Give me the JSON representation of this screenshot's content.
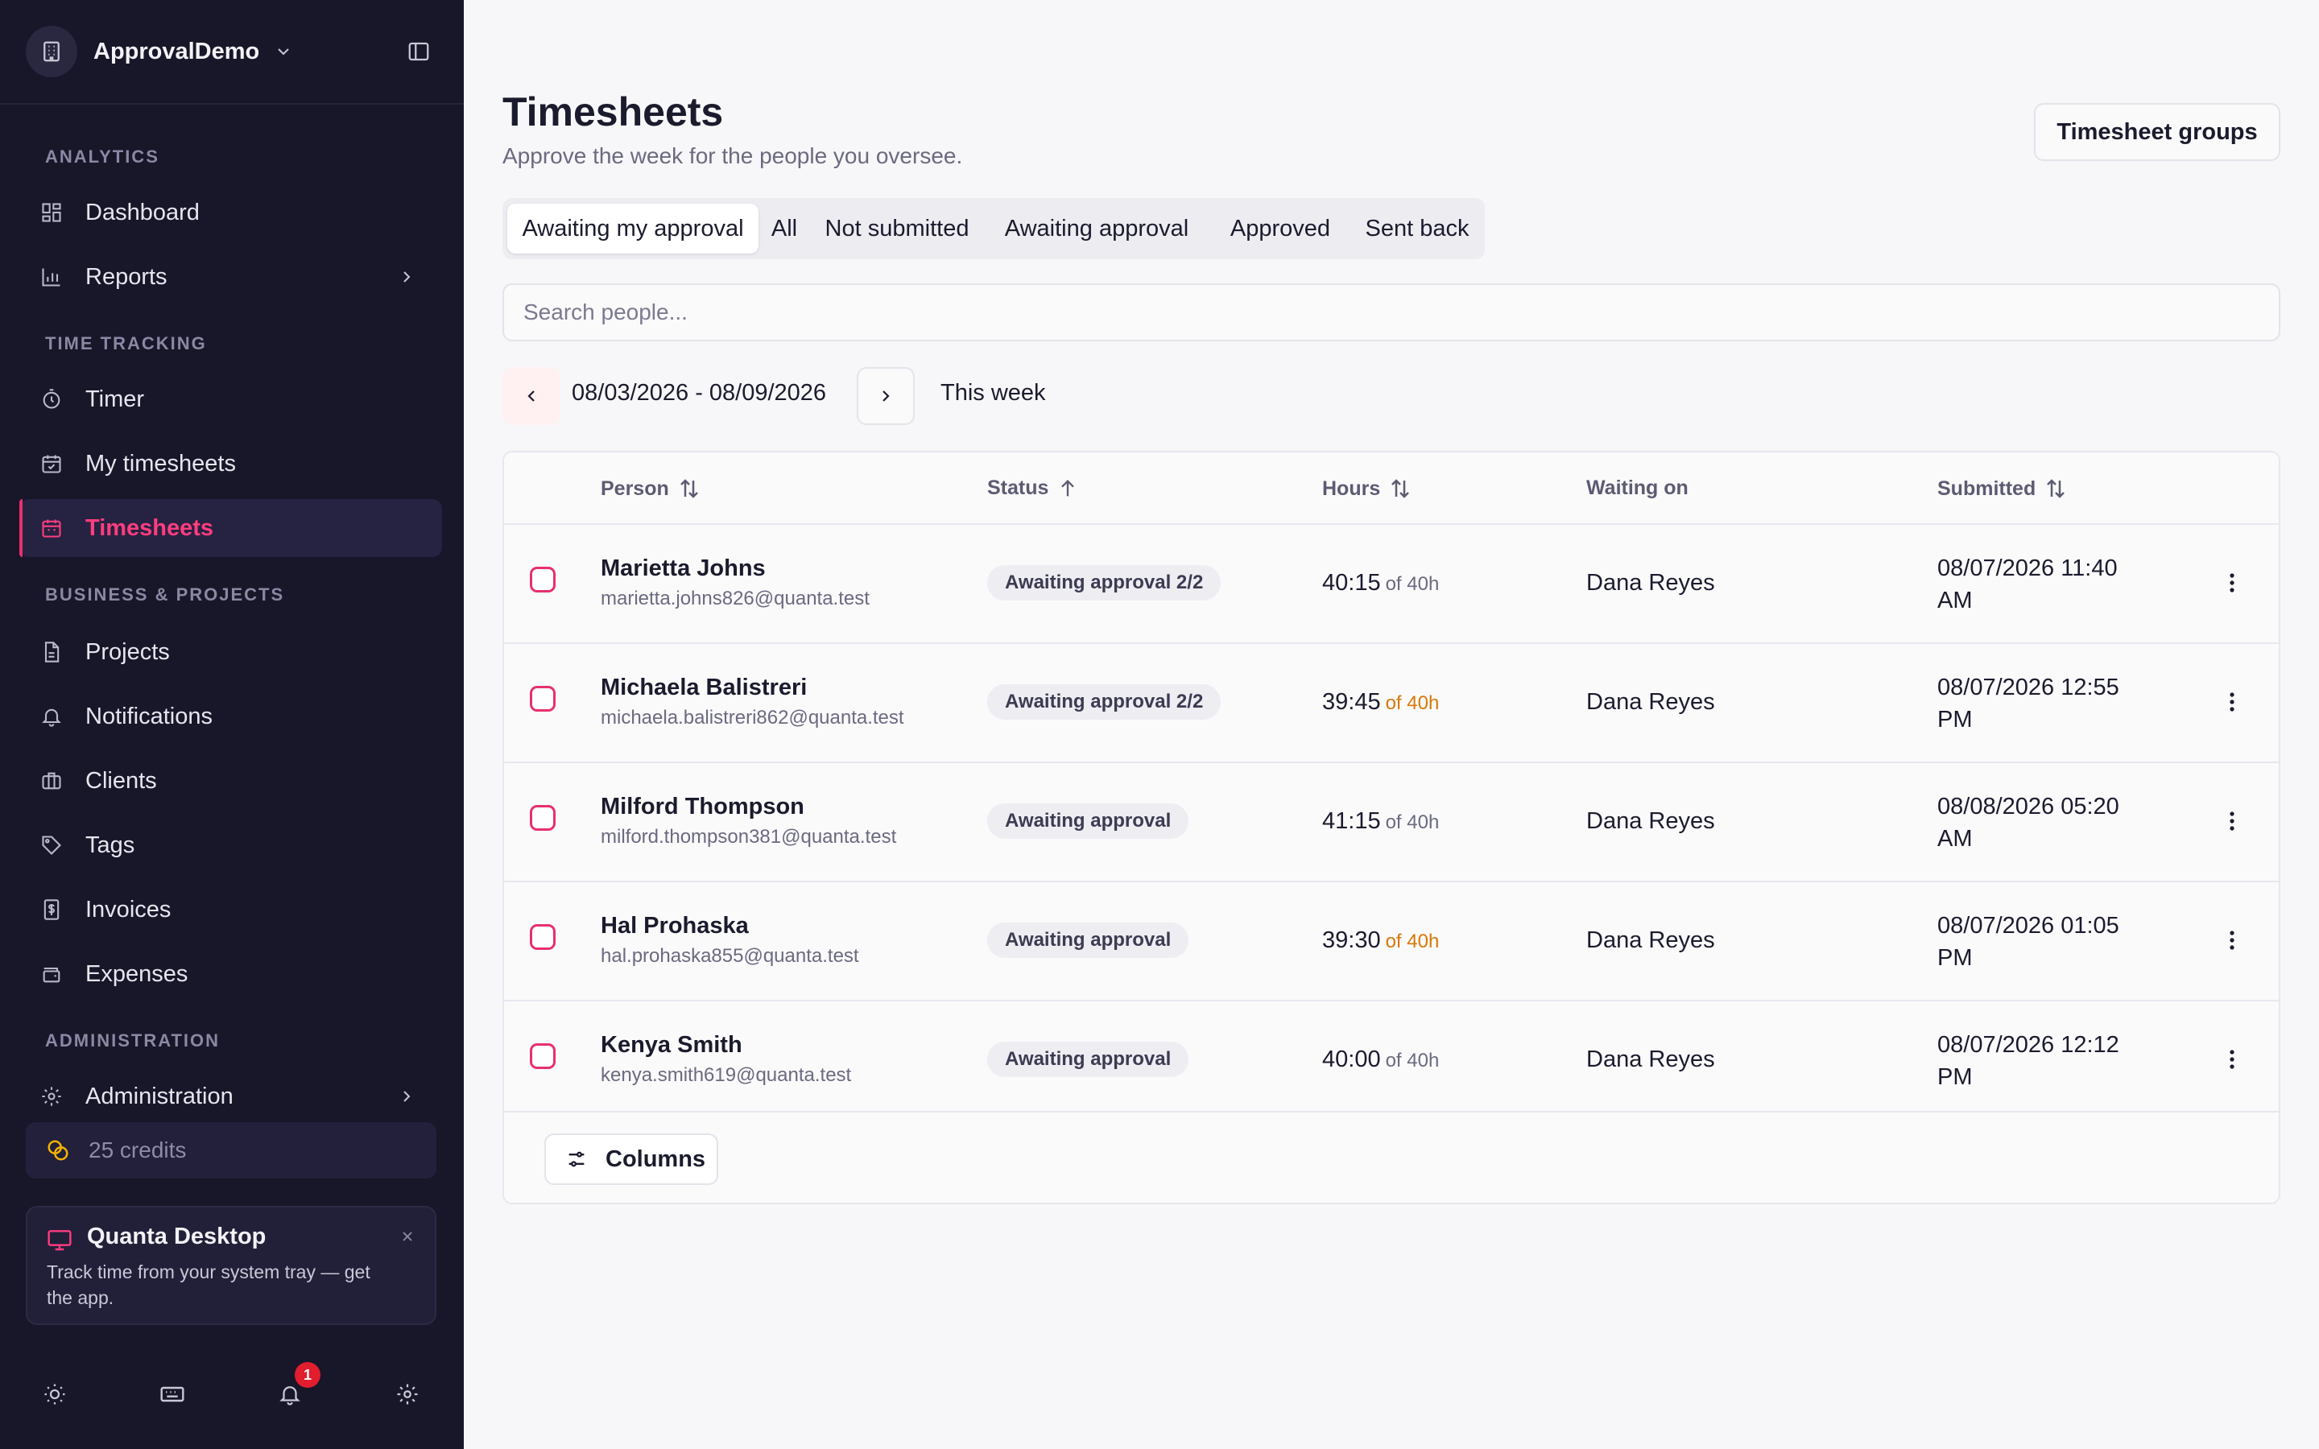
{
  "workspace": {
    "name": "ApprovalDemo"
  },
  "sidebar": {
    "sections": {
      "analytics": "ANALYTICS",
      "time_tracking": "TIME TRACKING",
      "business": "BUSINESS & PROJECTS",
      "administration": "ADMINISTRATION"
    },
    "items": [
      {
        "label": "Dashboard",
        "icon": "dashboard-icon"
      },
      {
        "label": "Reports",
        "icon": "bar-chart-icon"
      },
      {
        "label": "Timer",
        "icon": "stopwatch-icon"
      },
      {
        "label": "My timesheets",
        "icon": "calendar-check-icon"
      },
      {
        "label": "Timesheets",
        "icon": "calendar-icon",
        "active": true
      },
      {
        "label": "Projects",
        "icon": "document-icon"
      },
      {
        "label": "Notifications",
        "icon": "bell-icon"
      },
      {
        "label": "Clients",
        "icon": "briefcase-icon"
      },
      {
        "label": "Tags",
        "icon": "tag-icon"
      },
      {
        "label": "Invoices",
        "icon": "invoice-icon"
      },
      {
        "label": "Expenses",
        "icon": "wallet-icon"
      },
      {
        "label": "Administration",
        "icon": "gear-icon"
      }
    ],
    "credits": "25 credits",
    "promo": {
      "title": "Quanta Desktop",
      "body": "Track time from your system tray — get the app."
    },
    "notification_count": "1"
  },
  "page": {
    "title": "Timesheets",
    "subtitle": "Approve the week for the people you oversee.",
    "groups_button": "Timesheet groups",
    "tabs": [
      "Awaiting my approval",
      "All",
      "Not submitted",
      "Awaiting approval",
      "Approved",
      "Sent back"
    ],
    "active_tab": "Awaiting my approval",
    "search_placeholder": "Search people...",
    "date_range": "08/03/2026 - 08/09/2026",
    "this_week": "This week"
  },
  "table": {
    "headers": {
      "person": "Person",
      "status": "Status",
      "hours": "Hours",
      "waiting_on": "Waiting on",
      "submitted": "Submitted"
    },
    "rows": [
      {
        "name": "Marietta Johns",
        "email": "marietta.johns826@quanta.test",
        "status": "Awaiting approval 2/2",
        "hours": "40:15",
        "target": "of 40h",
        "target_warn": false,
        "waiting_on": "Dana Reyes",
        "submitted": "08/07/2026 11:40 AM"
      },
      {
        "name": "Michaela Balistreri",
        "email": "michaela.balistreri862@quanta.test",
        "status": "Awaiting approval 2/2",
        "hours": "39:45",
        "target": "of 40h",
        "target_warn": true,
        "waiting_on": "Dana Reyes",
        "submitted": "08/07/2026 12:55 PM"
      },
      {
        "name": "Milford Thompson",
        "email": "milford.thompson381@quanta.test",
        "status": "Awaiting approval",
        "hours": "41:15",
        "target": "of 40h",
        "target_warn": false,
        "waiting_on": "Dana Reyes",
        "submitted": "08/08/2026 05:20 AM"
      },
      {
        "name": "Hal Prohaska",
        "email": "hal.prohaska855@quanta.test",
        "status": "Awaiting approval",
        "hours": "39:30",
        "target": "of 40h",
        "target_warn": true,
        "waiting_on": "Dana Reyes",
        "submitted": "08/07/2026 01:05 PM"
      },
      {
        "name": "Kenya Smith",
        "email": "kenya.smith619@quanta.test",
        "status": "Awaiting approval",
        "hours": "40:00",
        "target": "of 40h",
        "target_warn": false,
        "waiting_on": "Dana Reyes",
        "submitted": "08/07/2026 12:12 PM"
      }
    ],
    "columns_button": "Columns"
  },
  "colors": {
    "accent": "#e8306b",
    "sidebar_bg": "#181629",
    "warn": "#d97706"
  }
}
